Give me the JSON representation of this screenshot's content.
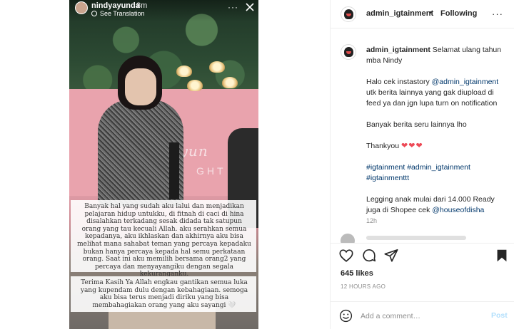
{
  "story": {
    "username": "nindyayunda",
    "time": "8m",
    "translate_label": "See Translation",
    "more_label": "···",
    "wall_script": "Ayun",
    "wall_text": "GHT",
    "caption_1": "Banyak hal yang sudah aku lalui dan menjadikan pelajaran hidup untukku,  di fitnah di caci di hina disalahkan terkadang sesak didada tak satupun orang yang tau kecuali Allah.  aku serahkan semua kepadanya, aku ikhlaskan dan akhirnya aku bisa melihat mana sahabat teman yang percaya kepadaku bukan hanya percaya kepada hal semu perkataan orang. Saat ini aku memilih bersama orang2 yang percaya dan menyayangiku dengan segala kekuranganku.",
    "caption_2": "Terima Kasih Ya Allah engkau gantikan semua luka yang kupendam dulu dengan kebahagiaan. semoga aku bisa terus menjadi diriku yang bisa membahagiakan orang yang aku sayangi 🤍"
  },
  "post": {
    "account": "admin_igtainment",
    "dot": "•",
    "follow_status": "Following",
    "more_label": "···",
    "comment": {
      "username": "admin_igtainment",
      "line1": "Selamat ulang tahun mba Nindy",
      "line2_pre": "Halo cek instastory",
      "line2_link": "@admin_igtainment",
      "line2_post": "utk berita lainnya yang gak diupload di feed ya dan jgn lupa turn on notification",
      "line3": "Banyak berita seru lainnya lho",
      "line4": "Thankyou",
      "hearts": "❤❤❤",
      "hashtags": "#igtainment #admin_igtainment #igtainmenttt",
      "line5_pre": "Legging anak mulai dari 14.000 Ready juga di Shopee cek",
      "line5_link": "@houseofdisha",
      "time": "12h"
    },
    "likes": "645 likes",
    "age": "12 HOURS AGO",
    "comment_placeholder": "Add a comment…",
    "post_label": "Post"
  },
  "colors": {
    "link": "#00376b",
    "heart": "#ed4956",
    "post_button": "#b2dffc"
  },
  "icons": [
    "close-icon",
    "translate-icon",
    "heart-icon",
    "comment-icon",
    "share-icon",
    "bookmark-icon",
    "emoji-icon"
  ]
}
